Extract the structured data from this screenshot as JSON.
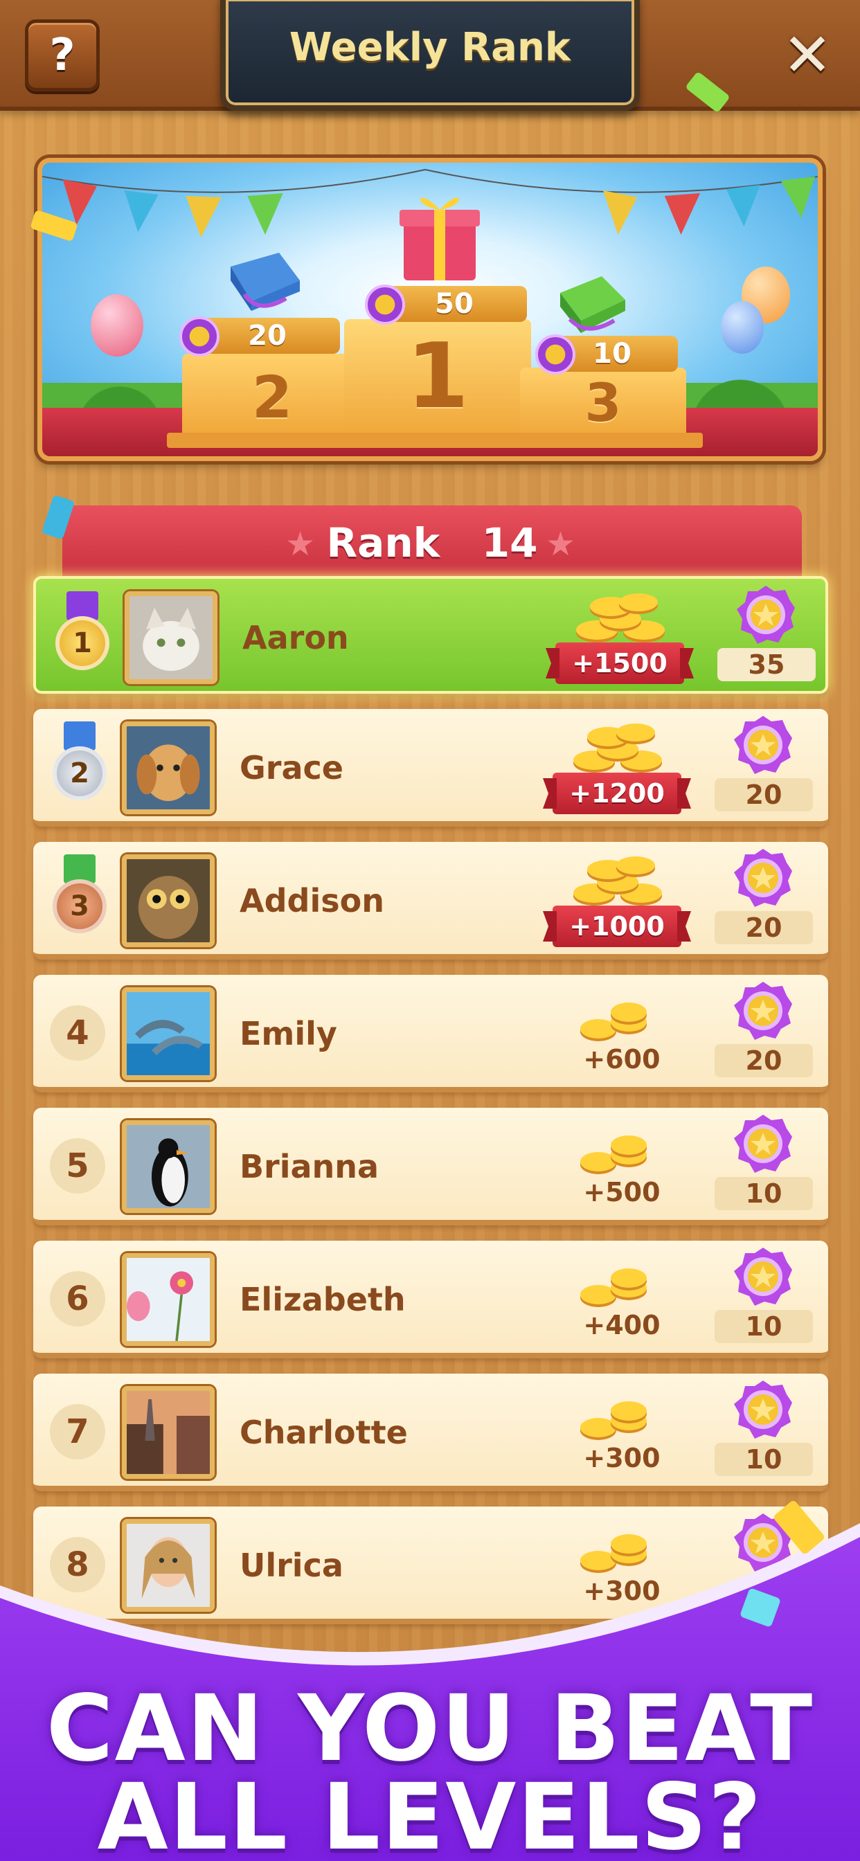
{
  "header": {
    "title": "Weekly Rank",
    "help_label": "?",
    "close_label": "✕"
  },
  "podium": {
    "first": {
      "place": "1",
      "reward": "50"
    },
    "second": {
      "place": "2",
      "reward": "20"
    },
    "third": {
      "place": "3",
      "reward": "10"
    }
  },
  "my_rank": {
    "label": "Rank",
    "value": "14"
  },
  "leaderboard": [
    {
      "rank": "1",
      "name": "Aaron",
      "coins": "+1500",
      "stars": "35",
      "highlight": true
    },
    {
      "rank": "2",
      "name": "Grace",
      "coins": "+1200",
      "stars": "20"
    },
    {
      "rank": "3",
      "name": "Addison",
      "coins": "+1000",
      "stars": "20"
    },
    {
      "rank": "4",
      "name": "Emily",
      "coins": "+600",
      "stars": "20"
    },
    {
      "rank": "5",
      "name": "Brianna",
      "coins": "+500",
      "stars": "10"
    },
    {
      "rank": "6",
      "name": "Elizabeth",
      "coins": "+400",
      "stars": "10"
    },
    {
      "rank": "7",
      "name": "Charlotte",
      "coins": "+300",
      "stars": "10"
    },
    {
      "rank": "8",
      "name": "Ulrica",
      "coins": "+300",
      "stars": ""
    }
  ],
  "promo": {
    "line1": "CAN YOU BEAT",
    "line2": "ALL LEVELS?"
  },
  "colors": {
    "wood": "#d2924a",
    "highlight_row": "#8fd43c",
    "rank_header": "#d63f4c",
    "promo_purple": "#8a2be2"
  }
}
